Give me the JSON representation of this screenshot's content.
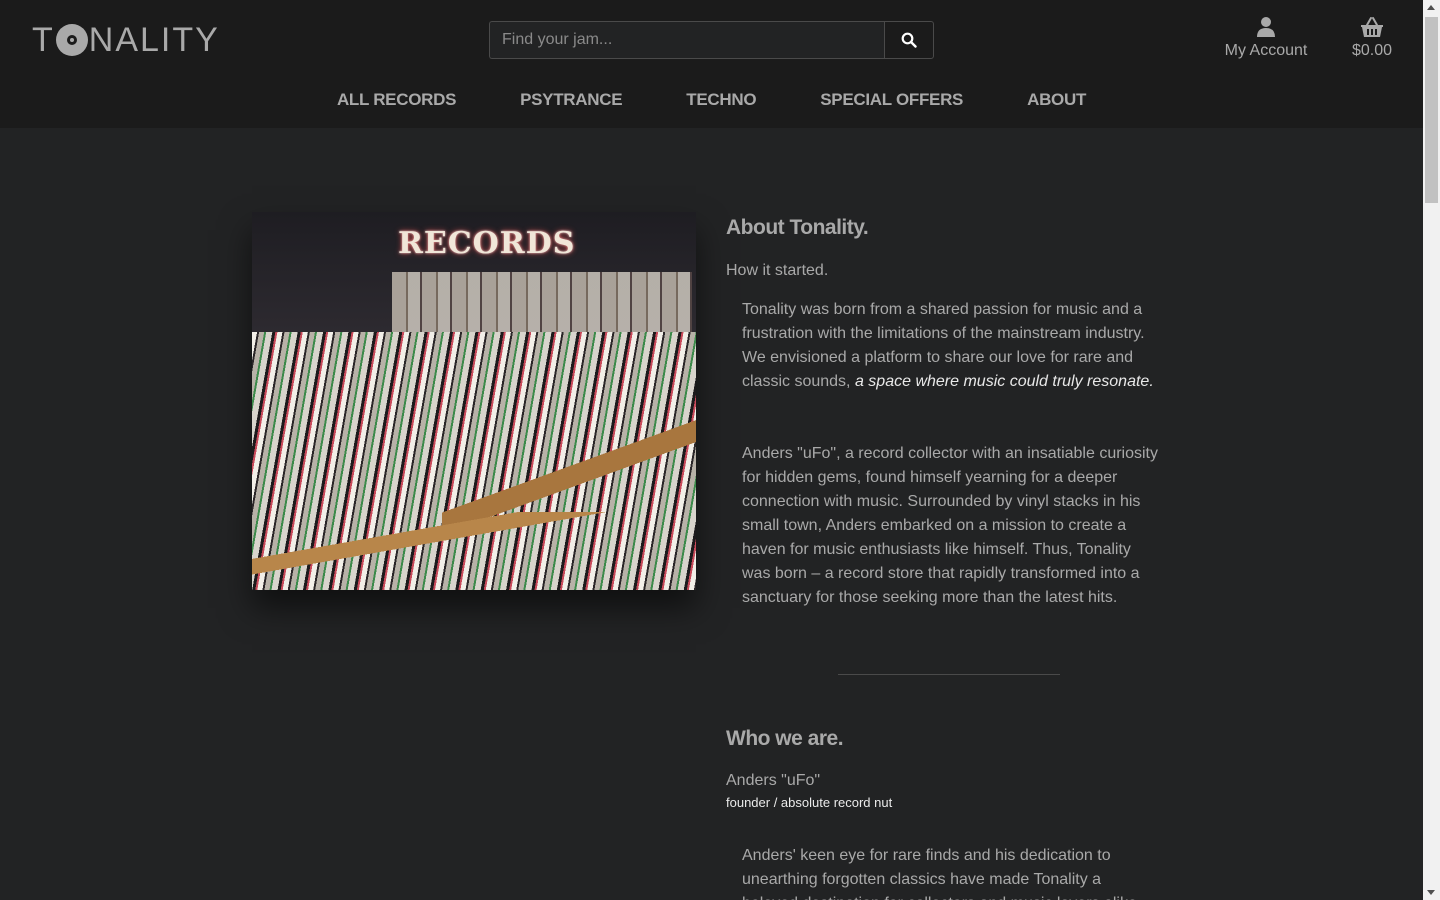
{
  "header": {
    "logo_text_pre": "T",
    "logo_text_post": "NALITY",
    "search_placeholder": "Find your jam...",
    "account_label": "My Account",
    "cart_total": "$0.00",
    "icons": {
      "search": "search-icon",
      "account": "user-icon",
      "cart": "basket-icon"
    }
  },
  "nav": {
    "items": [
      {
        "label": "ALL RECORDS"
      },
      {
        "label": "PSYTRANCE"
      },
      {
        "label": "TECHNO"
      },
      {
        "label": "SPECIAL OFFERS"
      },
      {
        "label": "ABOUT"
      }
    ]
  },
  "about": {
    "title": "About Tonality.",
    "subtitle": "How it started.",
    "p1_text": "Tonality was born from a shared passion for music and a frustration with the limitations of the mainstream industry. We envisioned a platform to share our love for rare and classic sounds,",
    "p1_emphasis": "a space where music could truly resonate.",
    "p2": "Anders \"uFo\", a record collector with an insatiable curiosity for hidden gems, found himself yearning for a deeper connection with music. Surrounded by vinyl stacks in his small town, Anders embarked on a mission to create a haven for music enthusiasts like himself. Thus, Tonality was born – a record store that rapidly transformed into a sanctuary for those seeking more than the latest hits.",
    "photo_sign": "RECORDS"
  },
  "who": {
    "title": "Who we are.",
    "name": "Anders \"uFo\"",
    "role": "founder / absolute record nut",
    "p1": "Anders' keen eye for rare finds and his dedication to unearthing forgotten classics have made Tonality a beloved destination for collectors and music lovers alike."
  },
  "colors": {
    "background": "#222324",
    "header": "#1b1b1b",
    "text": "#a9a9a9",
    "emphasis": "#e8e8e8"
  }
}
